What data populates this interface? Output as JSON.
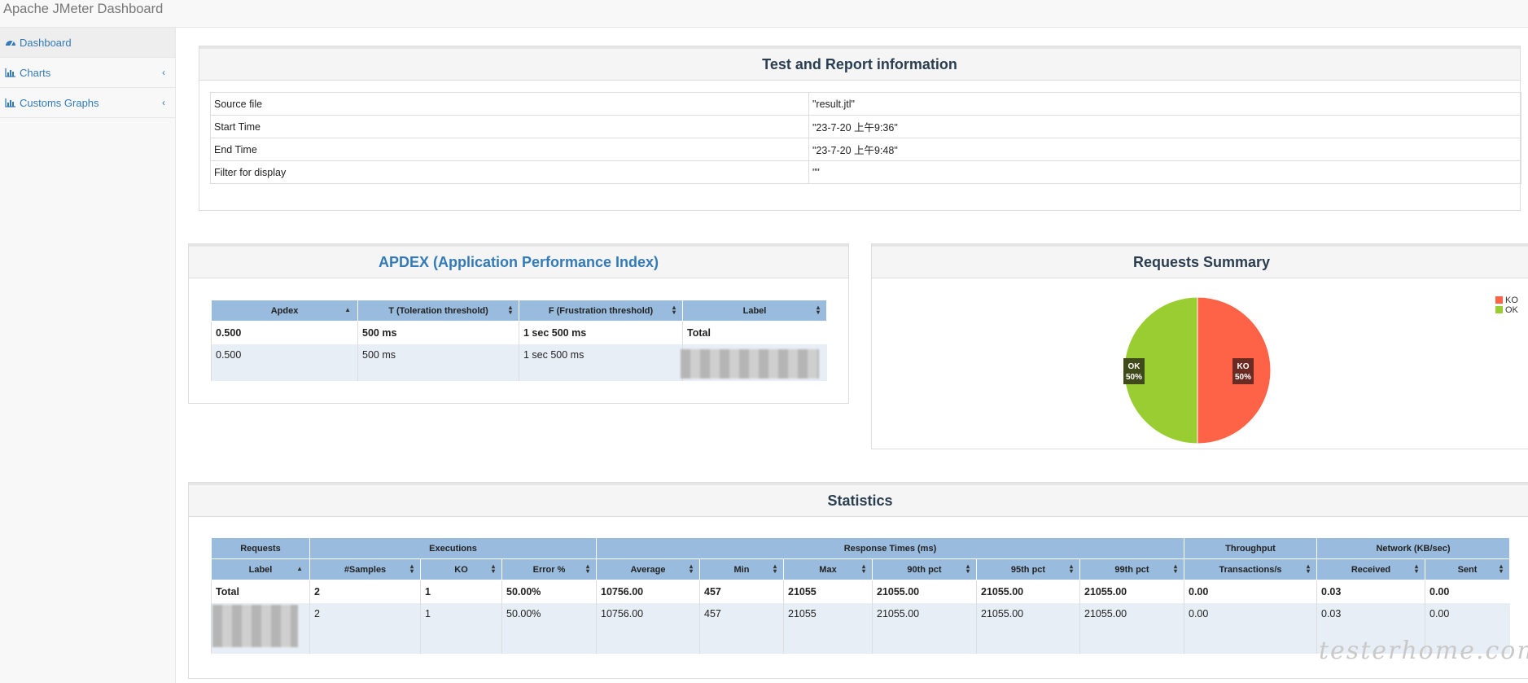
{
  "app": {
    "title": "Apache JMeter Dashboard"
  },
  "sidebar": {
    "items": [
      {
        "label": "Dashboard",
        "icon": "dashboard-icon",
        "active": true
      },
      {
        "label": "Charts",
        "icon": "bar-chart-icon"
      },
      {
        "label": "Customs Graphs",
        "icon": "bar-chart-icon"
      }
    ]
  },
  "test_info": {
    "title": "Test and Report information",
    "rows": [
      {
        "key": "Source file",
        "value": "\"result.jtl\""
      },
      {
        "key": "Start Time",
        "value": "\"23-7-20 上午9:36\""
      },
      {
        "key": "End Time",
        "value": "\"23-7-20 上午9:48\""
      },
      {
        "key": "Filter for display",
        "value": "\"\""
      }
    ]
  },
  "apdex": {
    "title": "APDEX (Application Performance Index)",
    "headers": [
      "Apdex",
      "T (Toleration threshold)",
      "F (Frustration threshold)",
      "Label"
    ],
    "total": [
      "0.500",
      "500 ms",
      "1 sec 500 ms",
      "Total"
    ],
    "row": [
      "0.500",
      "500 ms",
      "1 sec 500 ms",
      ""
    ]
  },
  "requests_summary": {
    "title": "Requests Summary",
    "slices": [
      {
        "name": "KO",
        "value": 50,
        "label": "50%",
        "color": "#ff6347"
      },
      {
        "name": "OK",
        "value": 50,
        "label": "50%",
        "color": "#9acd32"
      }
    ]
  },
  "statistics": {
    "title": "Statistics",
    "group_headers": [
      "Requests",
      "Executions",
      "Response Times (ms)",
      "Throughput",
      "Network (KB/sec)"
    ],
    "headers": [
      "Label",
      "#Samples",
      "KO",
      "Error %",
      "Average",
      "Min",
      "Max",
      "90th pct",
      "95th pct",
      "99th pct",
      "Transactions/s",
      "Received",
      "Sent"
    ],
    "total": [
      "Total",
      "2",
      "1",
      "50.00%",
      "10756.00",
      "457",
      "21055",
      "21055.00",
      "21055.00",
      "21055.00",
      "0.00",
      "0.03",
      "0.00"
    ],
    "row": [
      "",
      "2",
      "1",
      "50.00%",
      "10756.00",
      "457",
      "21055",
      "21055.00",
      "21055.00",
      "21055.00",
      "0.00",
      "0.03",
      "0.00"
    ]
  },
  "watermark": "testerhome.com",
  "colors": {
    "table_header": "#99bbdd",
    "link": "#337ab7",
    "ko": "#ff6347",
    "ok": "#9acd32"
  }
}
